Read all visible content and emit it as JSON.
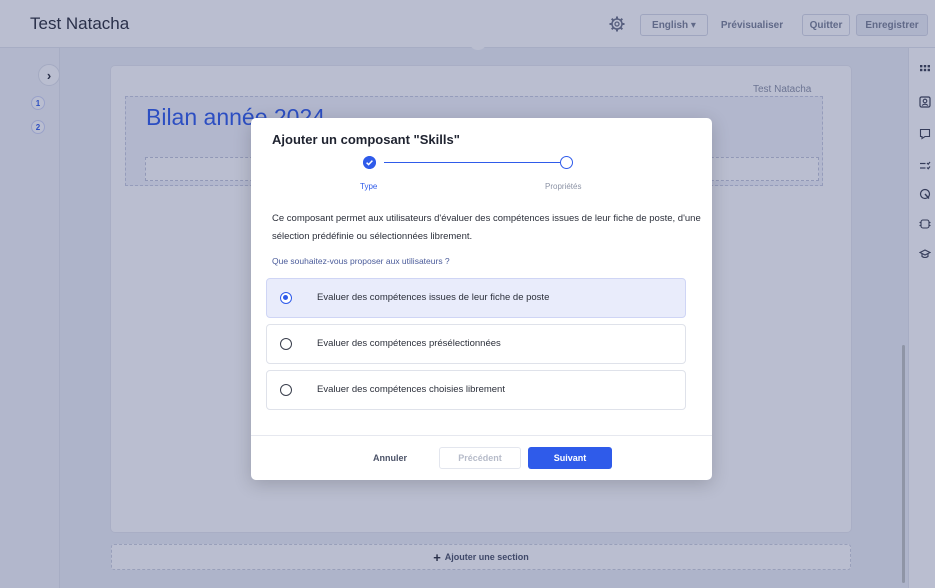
{
  "app": {
    "title": "Test Natacha"
  },
  "toolbar": {
    "language_label": "English ▾",
    "preview_label": "Prévisualiser",
    "quit_label": "Quitter",
    "save_label": "Enregistrer"
  },
  "left_nav": {
    "expand_glyph": "›",
    "steps": [
      "1",
      "2"
    ]
  },
  "right_rail": {
    "icons": [
      "grid-icon",
      "user-card-icon",
      "comment-box-icon",
      "list-check-icon",
      "badge-icon",
      "skills-icon",
      "graduation-cap-icon"
    ]
  },
  "document": {
    "author": "Test Natacha",
    "title": "Bilan année 2024",
    "add_section_label": "Ajouter une section"
  },
  "modal": {
    "title": "Ajouter un composant \"Skills\"",
    "steps": [
      {
        "label": "Type",
        "state": "done"
      },
      {
        "label": "Propriétés",
        "state": "todo"
      }
    ],
    "description": "Ce composant permet aux utilisateurs d'évaluer des compétences issues de leur fiche de poste, d'une sélection prédéfinie ou sélectionnées librement.",
    "question": "Que souhaitez-vous proposer aux utilisateurs ?",
    "options": [
      {
        "label": "Evaluer des compétences issues de leur fiche de poste",
        "selected": true
      },
      {
        "label": "Evaluer des compétences présélectionnées",
        "selected": false
      },
      {
        "label": "Evaluer des compétences choisies librement",
        "selected": false
      }
    ],
    "buttons": {
      "cancel": "Annuler",
      "previous": "Précédent",
      "next": "Suivant"
    }
  },
  "colors": {
    "accent": "#2f5bea",
    "overlay": "#28346e",
    "text": "#2b2f3a"
  }
}
